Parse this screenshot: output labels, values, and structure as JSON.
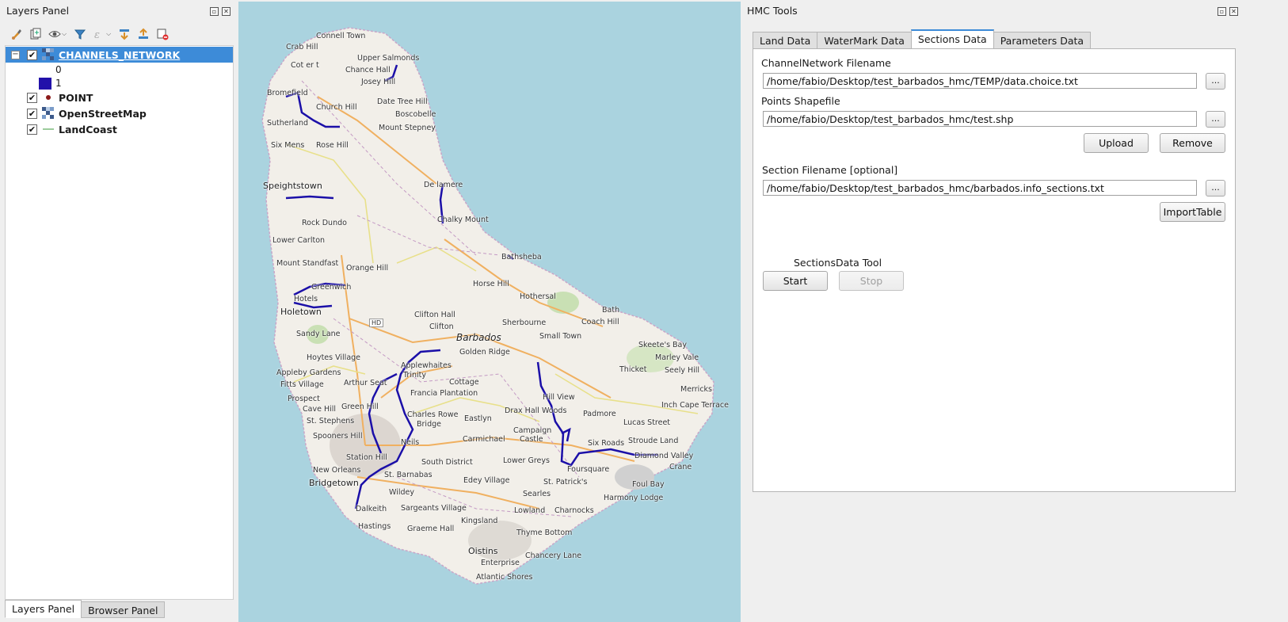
{
  "layers_panel": {
    "title": "Layers Panel",
    "layers": [
      {
        "name": "CHANNELS_NETWORK",
        "checked": true,
        "selected": true,
        "expanded": true,
        "legend": [
          {
            "label": "0",
            "color": ""
          },
          {
            "label": "1",
            "color": "#2211aa"
          }
        ]
      },
      {
        "name": "POINT",
        "checked": true,
        "icon": "point-marker-icon"
      },
      {
        "name": "OpenStreetMap",
        "checked": true,
        "icon": "raster-icon"
      },
      {
        "name": "LandCoast",
        "checked": true,
        "icon": "line-icon"
      }
    ],
    "bottom_tabs": [
      "Layers Panel",
      "Browser Panel"
    ],
    "toolbar_icons": [
      "style-brush-icon",
      "add-group-icon",
      "visibility-eye-icon",
      "filter-icon",
      "expression-filter-icon",
      "expand-all-icon",
      "collapse-all-icon",
      "remove-layer-icon"
    ]
  },
  "map": {
    "labels": {
      "island": "Barbados",
      "connell_town": "Connell Town",
      "crab_hill": "Crab Hill",
      "cottage": "Cottage",
      "cottage_n": "Cot er t",
      "upper_salmonds": "Upper Salmonds",
      "chance_hall": "Chance Hall",
      "josey_hill": "Josey Hill",
      "bromefield": "Bromefield",
      "church_hill": "Church Hill",
      "date_tree_hill": "Date Tree Hill",
      "boscobelle": "Boscobelle",
      "sutherland": "Sutherland",
      "mount_stepney": "Mount Stepney",
      "six_mens": "Six Mens",
      "rose_hill": "Rose Hill",
      "speightstown": "Speightstown",
      "de_lamere": "De lamere",
      "chalky_mount": "Chalky Mount",
      "rock_dundo": "Rock Dundo",
      "lower_carlton": "Lower Carlton",
      "mount_standfast": "Mount Standfast",
      "orange_hill": "Orange Hill",
      "bathsheba": "Bathsheba",
      "greenwich": "Greenwich",
      "horse_hill": "Horse Hill",
      "hotels": "Hotels",
      "holetown": "Holetown",
      "hothersal": "Hothersal",
      "bath": "Bath",
      "coach_hill": "Coach Hill",
      "hd": "HD",
      "clifton_hall": "Clifton Hall",
      "clifton": "Clifton",
      "sandy_lane": "Sandy Lane",
      "sherbourne": "Sherbourne",
      "small_town": "Small Town",
      "skeetes_bay": "Skeete's Bay",
      "golden_ridge": "Golden Ridge",
      "marley_vale": "Marley Vale",
      "hoytes_village": "Hoytes Village",
      "applewhaites": "Applewhaites",
      "seely_hill": "Seely Hill",
      "thicket": "Thicket",
      "appleby_gardens": "Appleby Gardens",
      "trinity": "Trinity",
      "fitts_village": "Fitts Village",
      "arthur_seat": "Arthur Seat",
      "cottage_c": "Cottage",
      "merricks": "Merricks",
      "prospect": "Prospect",
      "francia_plantation": "Francia Plantation",
      "hill_view": "Hill View",
      "cave_hill": "Cave Hill",
      "green_hill": "Green Hill",
      "inch_cape_terrace": "Inch Cape Terrace",
      "st_stephens": "St. Stephens",
      "charles_rowe_bridge": "Charles Rowe",
      "bridge": "Bridge",
      "drax_hall_woods": "Drax Hall Woods",
      "padmore": "Padmore",
      "lucas_street": "Lucas Street",
      "eastlyn": "Eastlyn",
      "campaign_castle": "Campaign",
      "castle": "Castle",
      "stroude_land": "Stroude Land",
      "spooners_hill": "Spooners Hill",
      "carmichael": "Carmichael",
      "six_roads": "Six Roads",
      "diamond_valley": "Diamond Valley",
      "neils": "Neils",
      "station_hill": "Station Hill",
      "south_district": "South District",
      "lower_greys": "Lower Greys",
      "crane": "Crane",
      "new_orleans": "New Orleans",
      "foursquare": "Foursquare",
      "st_barnabas": "St. Barnabas",
      "bridgetown": "Bridgetown",
      "edey_village": "Edey Village",
      "st_patricks": "St. Patrick's",
      "foul_bay": "Foul Bay",
      "wildey": "Wildey",
      "harmony_lodge": "Harmony Lodge",
      "searles": "Searles",
      "dalkeith": "Dalkeith",
      "sargeants_village": "Sargeants Village",
      "lowland": "Lowland",
      "charnocks": "Charnocks",
      "kingsland": "Kingsland",
      "hastings": "Hastings",
      "graeme_hall": "Graeme Hall",
      "thyme_bottom": "Thyme Bottom",
      "oistins": "Oistins",
      "chancery_lane": "Chancery Lane",
      "enterprise": "Enterprise",
      "atlantic_shores": "Atlantic Shores"
    }
  },
  "hmc_tools": {
    "title": "HMC Tools",
    "tabs": [
      {
        "label": "Land Data",
        "active": false
      },
      {
        "label": "WaterMark Data",
        "active": false
      },
      {
        "label": "Sections Data",
        "active": true
      },
      {
        "label": "Parameters Data",
        "active": false
      }
    ],
    "channel_network": {
      "label": "ChannelNetwork Filename",
      "value": "/home/fabio/Desktop/test_barbados_hmc/TEMP/data.choice.txt",
      "browse": "..."
    },
    "points_shapefile": {
      "label": "Points Shapefile",
      "value": "/home/fabio/Desktop/test_barbados_hmc/test.shp",
      "browse": "..."
    },
    "upload_label": "Upload",
    "remove_label": "Remove",
    "section_filename": {
      "label": "Section Filename [optional]",
      "value": "/home/fabio/Desktop/test_barbados_hmc/barbados.info_sections.txt",
      "browse": "..."
    },
    "import_table_label": "ImportTable",
    "tool_title": "SectionsData Tool",
    "start_label": "Start",
    "stop_label": "Stop",
    "stop_enabled": false
  },
  "colors": {
    "selection": "#3d8bd8",
    "channel_line": "#1b0fa8",
    "sea": "#aad3df",
    "land": "#f2efe9"
  }
}
